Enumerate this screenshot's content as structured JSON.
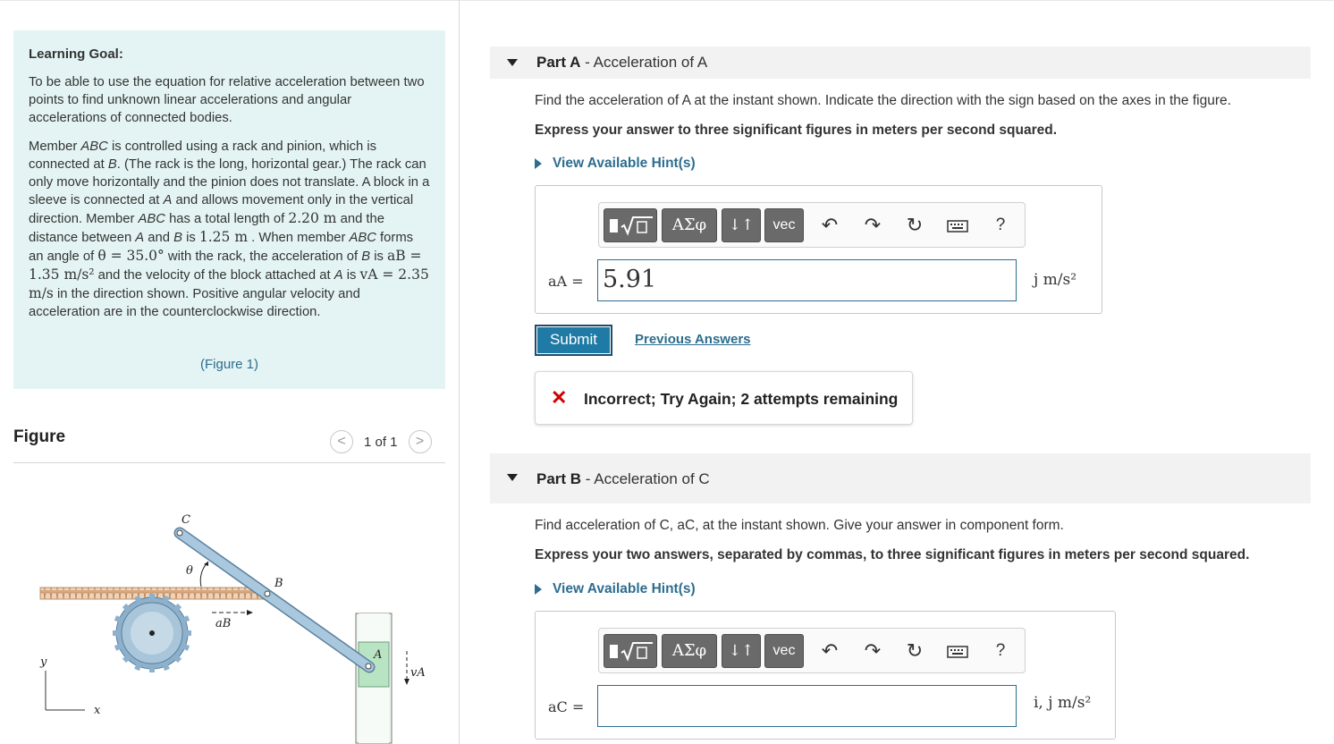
{
  "learning_goal": {
    "title": "Learning Goal:",
    "para1": "To be able to use the equation for relative acceleration between two points to find unknown linear accelerations and angular accelerations of connected bodies.",
    "p2": {
      "t1": "Member ",
      "abc": "ABC",
      "t2": " is controlled using a rack and pinion, which is connected at ",
      "b": "B",
      "t3": ". (The rack is the long, horizontal gear.) The rack can only move horizontally and the pinion does not translate. A block in a sleeve is connected at ",
      "a": "A",
      "t4": " and allows movement only in the vertical direction. Member ",
      "abc2": "ABC",
      "t5": " has a total length of ",
      "length": "2.20 m",
      "t6": " and the distance between ",
      "a2": "A",
      "t7": " and ",
      "b2": "B",
      "t8": " is ",
      "dist": "1.25 m",
      "t9": " . When member ",
      "abc3": "ABC",
      "t10": " forms an angle of ",
      "theta": "θ = 35.0°",
      "t11": " with the rack, the acceleration of ",
      "b3": "B",
      "t12": " is ",
      "aB": "aB = 1.35 m/s²",
      "t13": " and the velocity of the block attached at ",
      "a3": "A",
      "t14": " is ",
      "vA": "vA = 2.35 m/s",
      "t15": " in the direction shown. Positive angular velocity and acceleration are in the counterclockwise direction."
    },
    "figure_link": "(Figure 1)"
  },
  "figure": {
    "title": "Figure",
    "pager": "1 of 1",
    "prev_glyph": "<",
    "next_glyph": ">",
    "labels": {
      "c": "C",
      "theta": "θ",
      "b": "B",
      "a": "A",
      "aB": "aB",
      "vA": "vA",
      "y": "y",
      "x": "x"
    }
  },
  "part_a": {
    "title_bold": "Part A",
    "title_rest": " - Acceleration of A",
    "instruction": "Find the acceleration of A at the instant shown. Indicate the direction with the sign based on the axes in the figure.",
    "express": "Express your answer to three significant figures in meters per second squared.",
    "hint": "View Available Hint(s)",
    "label": "aA =",
    "value": "5.91",
    "unit": "j m/s²",
    "submit": "Submit",
    "previous_answers": "Previous Answers",
    "feedback_icon": "✕",
    "feedback": "Incorrect; Try Again; 2 attempts remaining"
  },
  "part_b": {
    "title_bold": "Part B",
    "title_rest": " - Acceleration of C",
    "instruction": "Find acceleration of C, aC, at the instant shown. Give your answer in component form.",
    "express": "Express your two answers, separated by commas, to three significant figures in meters per second squared.",
    "hint": "View Available Hint(s)",
    "label": "aC =",
    "value": "",
    "unit": "i, j m/s²"
  },
  "toolbar": {
    "greek": "ΑΣφ",
    "arrows": "↓↑",
    "vec": "vec",
    "help": "?"
  },
  "colors": {
    "goal_bg": "#e4f4f4",
    "link": "#2d6d8f",
    "submit_bg": "#1f7aa5",
    "error": "#d20000"
  }
}
